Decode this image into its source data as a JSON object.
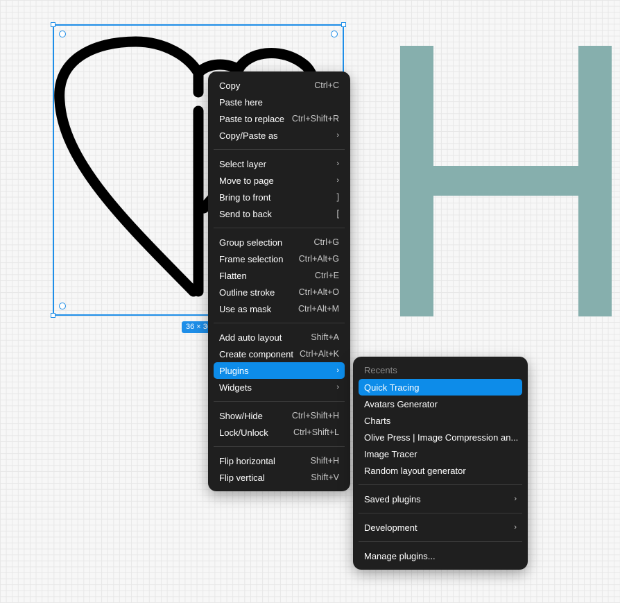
{
  "selection": {
    "size_label": "36 × 36"
  },
  "colors": {
    "accent": "#1e8ee8",
    "menu_bg": "#1f1f1f",
    "highlight": "#0d8ce9",
    "h_glyph": "#86afad"
  },
  "context_menu": {
    "groups": [
      [
        {
          "label": "Copy",
          "shortcut": "Ctrl+C"
        },
        {
          "label": "Paste here",
          "shortcut": ""
        },
        {
          "label": "Paste to replace",
          "shortcut": "Ctrl+Shift+R"
        },
        {
          "label": "Copy/Paste as",
          "shortcut": "›"
        }
      ],
      [
        {
          "label": "Select layer",
          "shortcut": "›"
        },
        {
          "label": "Move to page",
          "shortcut": "›"
        },
        {
          "label": "Bring to front",
          "shortcut": "]"
        },
        {
          "label": "Send to back",
          "shortcut": "["
        }
      ],
      [
        {
          "label": "Group selection",
          "shortcut": "Ctrl+G"
        },
        {
          "label": "Frame selection",
          "shortcut": "Ctrl+Alt+G"
        },
        {
          "label": "Flatten",
          "shortcut": "Ctrl+E"
        },
        {
          "label": "Outline stroke",
          "shortcut": "Ctrl+Alt+O"
        },
        {
          "label": "Use as mask",
          "shortcut": "Ctrl+Alt+M"
        }
      ],
      [
        {
          "label": "Add auto layout",
          "shortcut": "Shift+A"
        },
        {
          "label": "Create component",
          "shortcut": "Ctrl+Alt+K"
        },
        {
          "label": "Plugins",
          "shortcut": "›"
        },
        {
          "label": "Widgets",
          "shortcut": "›"
        }
      ],
      [
        {
          "label": "Show/Hide",
          "shortcut": "Ctrl+Shift+H"
        },
        {
          "label": "Lock/Unlock",
          "shortcut": "Ctrl+Shift+L"
        }
      ],
      [
        {
          "label": "Flip horizontal",
          "shortcut": "Shift+H"
        },
        {
          "label": "Flip vertical",
          "shortcut": "Shift+V"
        }
      ]
    ]
  },
  "plugins_menu": {
    "recents_title": "Recents",
    "recents": [
      "Quick Tracing",
      "Avatars Generator",
      "Charts",
      "Olive Press | Image Compression an...",
      "Image Tracer",
      "Random layout generator"
    ],
    "saved_label": "Saved plugins",
    "saved_arrow": "›",
    "development_label": "Development",
    "development_arrow": "›",
    "manage_label": "Manage plugins..."
  }
}
